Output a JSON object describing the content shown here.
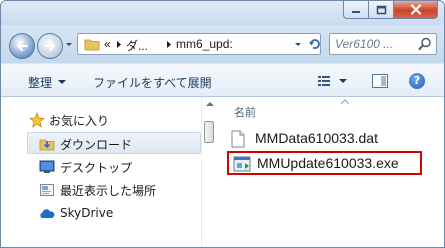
{
  "window": {
    "controls": {
      "minimize_icon": "minimize-icon",
      "maximize_icon": "maximize-icon",
      "close_icon": "close-icon"
    }
  },
  "navigation": {
    "back_icon": "back-arrow-icon",
    "forward_icon": "forward-arrow-icon",
    "address": {
      "overflow_symbol": "«",
      "segments": [
        "ダ...",
        "mm6_upd:"
      ]
    },
    "search": {
      "placeholder": "Ver6100 ..."
    }
  },
  "command_bar": {
    "organize_label": "整理",
    "play_all_label": "ファイルをすべて展開",
    "view_icon": "view-options-icon",
    "preview_pane_icon": "preview-pane-icon",
    "help_label": "?"
  },
  "nav_pane": {
    "favorites_label": "お気に入り",
    "items": [
      {
        "label": "ダウンロード",
        "icon": "download-folder-icon",
        "selected": true
      },
      {
        "label": "デスクトップ",
        "icon": "desktop-icon",
        "selected": false
      },
      {
        "label": "最近表示した場所",
        "icon": "recent-places-icon",
        "selected": false
      },
      {
        "label": "SkyDrive",
        "icon": "skydrive-icon",
        "selected": false
      }
    ]
  },
  "file_list": {
    "column_name": "名前",
    "files": [
      {
        "name": "MMData610033.dat",
        "icon": "file-icon",
        "highlighted": false
      },
      {
        "name": "MMUpdate610033.exe",
        "icon": "exe-icon",
        "highlighted": true
      }
    ]
  },
  "colors": {
    "highlight_border": "#d60000",
    "chrome": "#c6dbee"
  }
}
